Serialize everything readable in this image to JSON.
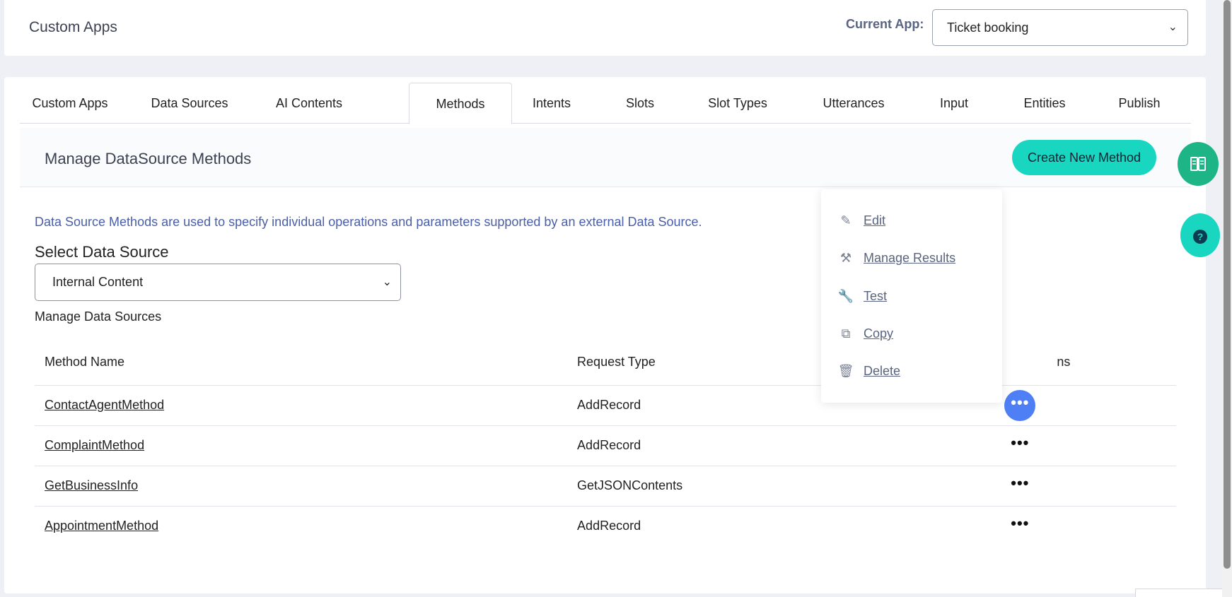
{
  "header": {
    "app_title": "Custom Apps",
    "current_app_label": "Current App:",
    "current_app_value": "Ticket booking"
  },
  "tabs": [
    {
      "label": "Custom Apps"
    },
    {
      "label": "Data Sources"
    },
    {
      "label": "AI Contents"
    },
    {
      "label": "Methods"
    },
    {
      "label": "Intents"
    },
    {
      "label": "Slots"
    },
    {
      "label": "Slot Types"
    },
    {
      "label": "Utterances"
    },
    {
      "label": "Input"
    },
    {
      "label": "Entities"
    },
    {
      "label": "Publish"
    }
  ],
  "active_tab": "Methods",
  "section": {
    "title": "Manage DataSource Methods",
    "create_button": "Create New Method"
  },
  "content": {
    "description": "Data Source Methods are used to specify individual operations and parameters supported by an external Data Source.",
    "select_label": "Select Data Source",
    "selected_source": "Internal Content",
    "manage_link": "Manage Data Sources"
  },
  "table": {
    "headers": {
      "name": "Method Name",
      "request": "Request Type",
      "actions": "ns"
    },
    "rows": [
      {
        "name": "ContactAgentMethod",
        "request": "AddRecord",
        "actions": "•••"
      },
      {
        "name": "ComplaintMethod",
        "request": "AddRecord",
        "actions": "•••"
      },
      {
        "name": "GetBusinessInfo",
        "request": "GetJSONContents",
        "actions": "•••"
      },
      {
        "name": "AppointmentMethod",
        "request": "AddRecord",
        "actions": "•••"
      }
    ]
  },
  "menu": {
    "items": [
      {
        "label": "Edit",
        "icon": "pencil-icon"
      },
      {
        "label": "Manage Results",
        "icon": "gavel-icon"
      },
      {
        "label": "Test",
        "icon": "wrench-icon"
      },
      {
        "label": "Copy",
        "icon": "copy-icon"
      },
      {
        "label": "Delete",
        "icon": "trash-icon"
      }
    ]
  },
  "floating": {
    "book_icon": "book-icon",
    "help_icon": "question-icon"
  },
  "colors": {
    "accent": "#19d6c1",
    "book_button": "#1db586",
    "actions_active": "#4e7ff5",
    "link_text": "#4a5fa8"
  }
}
